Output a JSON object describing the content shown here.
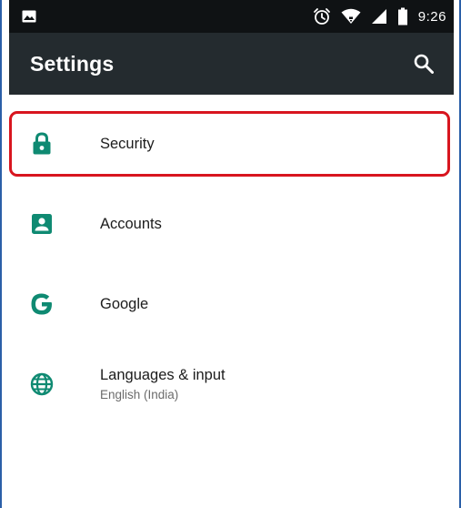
{
  "status_bar": {
    "time": "9:26",
    "icons": [
      "image-icon",
      "alarm-icon",
      "wifi-icon",
      "signal-icon",
      "battery-icon"
    ]
  },
  "app_bar": {
    "title": "Settings",
    "search_icon": "search-icon"
  },
  "settings": {
    "items": [
      {
        "icon": "lock-icon",
        "title": "Security",
        "subtitle": "",
        "highlighted": true
      },
      {
        "icon": "account-box-icon",
        "title": "Accounts",
        "subtitle": ""
      },
      {
        "icon": "google-icon",
        "title": "Google",
        "subtitle": ""
      },
      {
        "icon": "globe-icon",
        "title": "Languages & input",
        "subtitle": "English (India)"
      }
    ]
  },
  "colors": {
    "status_bar_bg": "#0f1214",
    "app_bar_bg": "#242b2f",
    "icon_accent": "#0f8a72",
    "highlight_border": "#d8151f",
    "frame_border": "#2b5fa8"
  }
}
